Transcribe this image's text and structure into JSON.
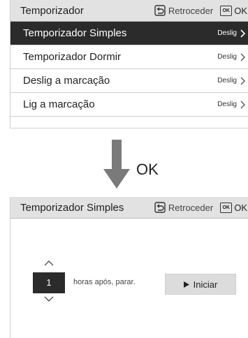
{
  "top_panel": {
    "header": {
      "title": "Temporizador",
      "back_label": "Retroceder",
      "ok_icon_text": "OK",
      "ok_label": "OK"
    },
    "items": [
      {
        "label": "Temporizador Simples",
        "value": "Deslig"
      },
      {
        "label": "Temporizador Dormir",
        "value": "Deslig"
      },
      {
        "label": "Deslig a marcação",
        "value": "Deslig"
      },
      {
        "label": "Lig a marcação",
        "value": "Deslig"
      }
    ]
  },
  "transition": {
    "label": "OK",
    "arrow_color": "#7a7a7a"
  },
  "bottom_panel": {
    "header": {
      "title": "Temporizador Simples",
      "back_label": "Retroceder",
      "ok_icon_text": "OK",
      "ok_label": "OK"
    },
    "stepper": {
      "value": "1",
      "suffix": "horas após, parar."
    },
    "start_button": {
      "label": "Iniciar"
    }
  },
  "colors": {
    "selected_bg": "#2b2b2b",
    "header_bg": "#e2e2e2"
  }
}
